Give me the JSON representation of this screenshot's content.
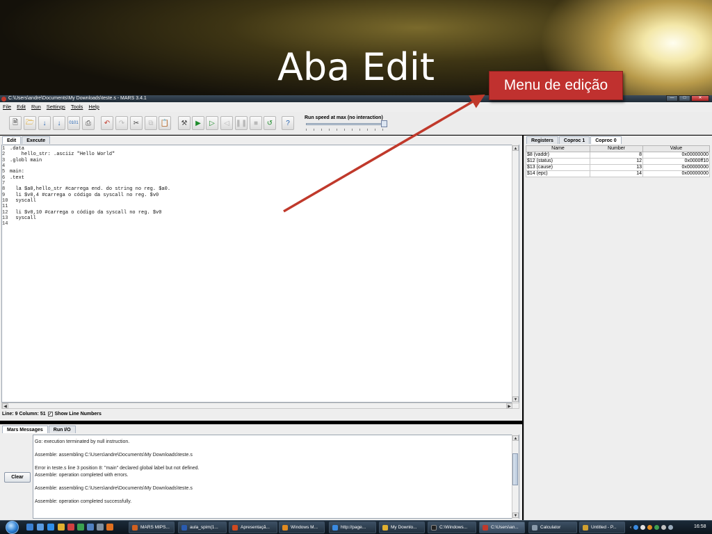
{
  "slide": {
    "title": "Aba Edit",
    "callout": "Menu de edição"
  },
  "window": {
    "title": "C:\\Users\\andre\\Documents\\My Downloads\\teste.s  - MARS 3.4.1"
  },
  "menu": [
    "File",
    "Edit",
    "Run",
    "Settings",
    "Tools",
    "Help"
  ],
  "toolbar": {
    "speed_label": "Run speed at max (no interaction)"
  },
  "editor": {
    "tabs": [
      "Edit",
      "Execute"
    ],
    "line_numbers": [
      "1",
      "2",
      "3",
      "4",
      "5",
      "6",
      "7",
      "8",
      "9",
      "10",
      "11",
      "12",
      "13",
      "14"
    ],
    "code": ".data\n    hello_str: .asciiz \"Hello World\"\n.globl main\n\nmain:\n.text\n\n  la $a0,hello_str #carrega end. do string no reg. $a0.\n  li $v0,4 #carrega o código da syscall no reg. $v0\n  syscall\n\n  li $v0,10 #carrega o código da syscall no reg. $v0\n  syscall\n",
    "status": "Line: 9 Column: 51",
    "show_line_numbers": "Show Line Numbers"
  },
  "messages": {
    "tabs": [
      "Mars Messages",
      "Run I/O"
    ],
    "clear": "Clear",
    "text": "Go: execution terminated by null instruction.\n\nAssemble: assembling C:\\Users\\andre\\Documents\\My Downloads\\teste.s\n\nError in teste.s line 3 position 8: \"main\" declared global label but not defined.\nAssemble: operation completed with errors.\n\nAssemble: assembling C:\\Users\\andre\\Documents\\My Downloads\\teste.s\n\nAssemble: operation completed successfully."
  },
  "registers": {
    "tabs": [
      "Registers",
      "Coproc 1",
      "Coproc 0"
    ],
    "columns": [
      "Name",
      "Number",
      "Value"
    ],
    "rows": [
      [
        "$8 (vaddr)",
        "8",
        "0x00000000"
      ],
      [
        "$12 (status)",
        "12",
        "0x0000ff10"
      ],
      [
        "$13 (cause)",
        "13",
        "0x00000000"
      ],
      [
        "$14 (epc)",
        "14",
        "0x00000000"
      ]
    ]
  },
  "taskbar": {
    "tasks": [
      "MARS MIPS...",
      "aula_spim(1...",
      "Apresentaçã...",
      "Windows M...",
      "http://page...",
      "My Downlo...",
      "C:\\Windows...",
      "C:\\Users\\an...",
      "Calculator",
      "Untitled - P..."
    ],
    "clock": "16:58"
  },
  "colors": {
    "accent": "#c0312f",
    "arrow": "#c0392b",
    "taskbar": "#1b2a39"
  }
}
